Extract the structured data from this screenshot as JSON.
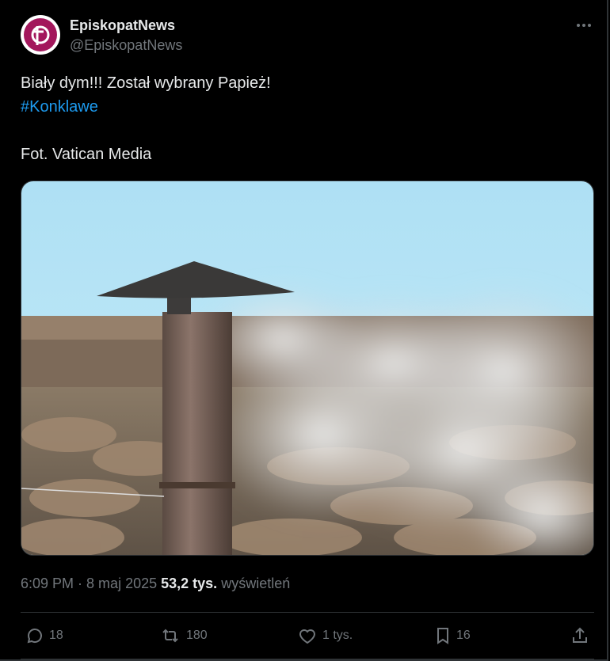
{
  "author": {
    "display_name": "EpiskopatNews",
    "handle": "@EpiskopatNews",
    "avatar_icon": "cross-logo-icon",
    "brand_color": "#a3175c"
  },
  "tweet": {
    "line1": "Biały dym!!! Został wybrany Papież!",
    "hashtag": "#Konklawe",
    "credit": "Fot. Vatican Media"
  },
  "meta": {
    "time": "6:09 PM",
    "separator": " · ",
    "date": "8 maj 2025",
    "views_count": "53,2 tys.",
    "views_label": "wyświetleń"
  },
  "actions": {
    "replies": "18",
    "retweets": "180",
    "likes": "1 tys.",
    "bookmarks": "16"
  },
  "colors": {
    "link": "#1d9bf0",
    "muted": "#71767b",
    "text": "#e7e9ea"
  }
}
